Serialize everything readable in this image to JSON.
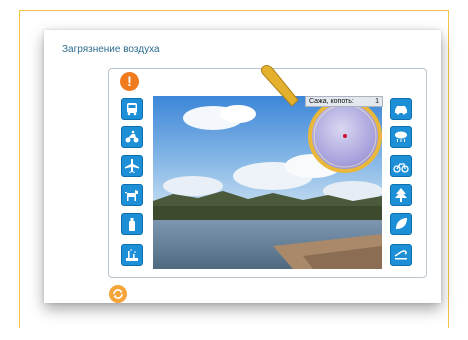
{
  "title": "Загрязнение воздуха",
  "readout": {
    "label": "Сажа, копоть:",
    "value": "1"
  },
  "left_buttons": [
    {
      "icon": "bus-icon"
    },
    {
      "icon": "motorcycle-icon"
    },
    {
      "icon": "airplane-icon"
    },
    {
      "icon": "dog-icon"
    },
    {
      "icon": "spray-can-icon"
    },
    {
      "icon": "factory-icon"
    }
  ],
  "right_buttons": [
    {
      "icon": "car-icon"
    },
    {
      "icon": "rain-cloud-icon"
    },
    {
      "icon": "bicycle-icon"
    },
    {
      "icon": "tree-icon"
    },
    {
      "icon": "leaf-icon"
    },
    {
      "icon": "wind-icon"
    }
  ],
  "colors": {
    "accent": "#1d8fd6",
    "warning": "#f07a1e",
    "title": "#2d6c8f"
  }
}
